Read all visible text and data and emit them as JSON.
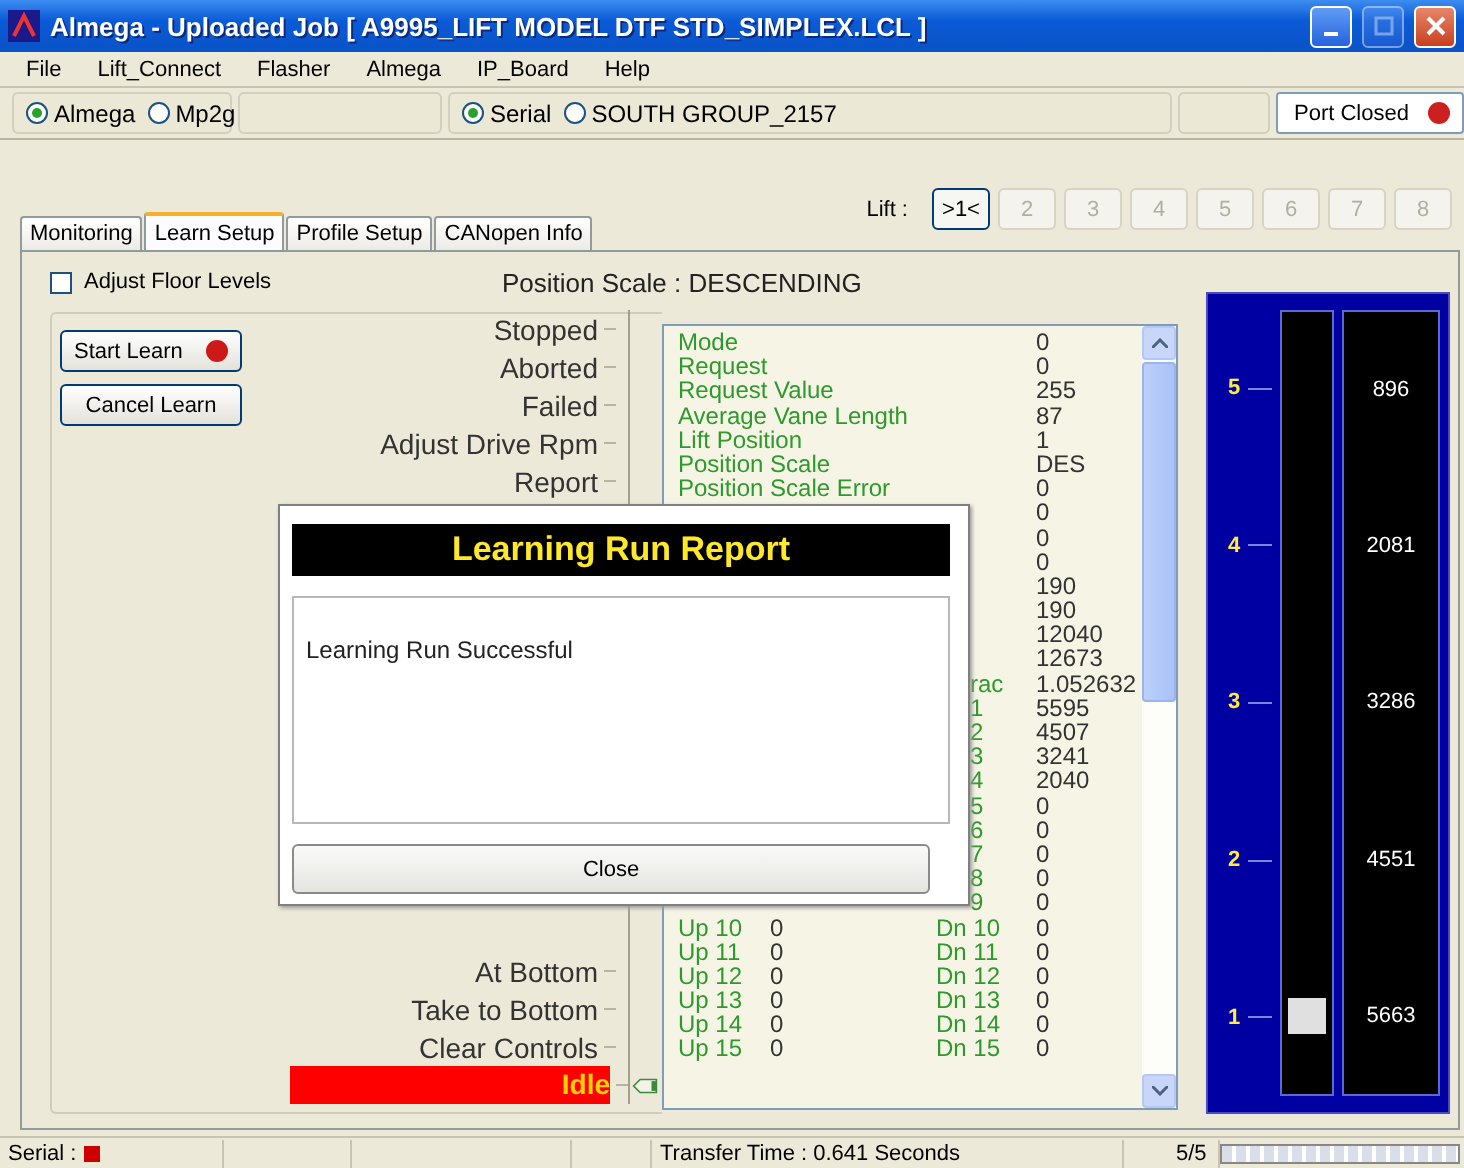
{
  "window": {
    "title": "Almega - Uploaded Job [ A9995_LIFT MODEL DTF STD_SIMPLEX.LCL ]",
    "controls": [
      {
        "kind": "minimize",
        "disabled": false
      },
      {
        "kind": "maximize",
        "disabled": true
      },
      {
        "kind": "close",
        "disabled": false
      }
    ]
  },
  "menu": [
    "File",
    "Lift_Connect",
    "Flasher",
    "Almega",
    "IP_Board",
    "Help"
  ],
  "toolbar": {
    "protocol": [
      {
        "label": "Almega",
        "selected": true
      },
      {
        "label": "Mp2g",
        "selected": false
      }
    ],
    "connection": [
      {
        "label": "Serial",
        "selected": true
      },
      {
        "label": "SOUTH GROUP_2157",
        "selected": false
      }
    ],
    "port": {
      "label": "Port Closed",
      "color": "#cc1f1f"
    }
  },
  "lift_selector": {
    "label": "Lift :",
    "buttons": [
      {
        "label": ">1<",
        "selected": true,
        "disabled": false
      },
      {
        "label": "2",
        "selected": false,
        "disabled": true
      },
      {
        "label": "3",
        "selected": false,
        "disabled": true
      },
      {
        "label": "4",
        "selected": false,
        "disabled": true
      },
      {
        "label": "5",
        "selected": false,
        "disabled": true
      },
      {
        "label": "6",
        "selected": false,
        "disabled": true
      },
      {
        "label": "7",
        "selected": false,
        "disabled": true
      },
      {
        "label": "8",
        "selected": false,
        "disabled": true
      }
    ]
  },
  "tabs": [
    {
      "label": "Monitoring",
      "selected": false
    },
    {
      "label": "Learn Setup",
      "selected": true
    },
    {
      "label": "Profile Setup",
      "selected": false
    },
    {
      "label": "CANopen Info",
      "selected": false
    }
  ],
  "adjust_floor_levels": {
    "label": "Adjust Floor Levels",
    "checked": false
  },
  "position_scale": "Position Scale : DESCENDING",
  "buttons": [
    {
      "label": "Start Learn",
      "indicator": true
    },
    {
      "label": "Cancel Learn",
      "indicator": false
    }
  ],
  "steps_top": [
    "Stopped",
    "Aborted",
    "Failed",
    "Adjust Drive Rpm",
    "Report"
  ],
  "steps_bottom": [
    "At Bottom",
    "Take to Bottom",
    "Clear Controls"
  ],
  "current_step": {
    "label": "Idle",
    "active": true
  },
  "parameters": [
    {
      "kind": "param",
      "label": "Mode",
      "value": "0"
    },
    {
      "kind": "param",
      "label": "Request",
      "value": "0"
    },
    {
      "kind": "param",
      "label": "Request Value",
      "value": "255"
    },
    {
      "kind": "param",
      "label": "Average Vane Length",
      "value": "87"
    },
    {
      "kind": "param",
      "label": "Lift Position",
      "value": "1"
    },
    {
      "kind": "param",
      "label": "Position Scale",
      "value": "DES"
    },
    {
      "kind": "param",
      "label": "Position Scale Error",
      "value": "0"
    },
    {
      "kind": "value",
      "value": "0"
    },
    {
      "kind": "value",
      "value": "0"
    },
    {
      "kind": "value",
      "value": "0"
    },
    {
      "kind": "value",
      "value": "190"
    },
    {
      "kind": "value",
      "value": "190"
    },
    {
      "kind": "value",
      "value": "12040"
    },
    {
      "kind": "value",
      "value": "12673"
    },
    {
      "kind": "tail",
      "label": "rac",
      "value": "1.052632"
    },
    {
      "kind": "tail",
      "label": "1",
      "value": "5595"
    },
    {
      "kind": "tail",
      "label": "2",
      "value": "4507"
    },
    {
      "kind": "tail",
      "label": "3",
      "value": "3241"
    },
    {
      "kind": "tail",
      "label": "4",
      "value": "2040"
    },
    {
      "kind": "tail",
      "label": "5",
      "value": "0"
    },
    {
      "kind": "tail",
      "label": "6",
      "value": "0"
    },
    {
      "kind": "tail",
      "label": "7",
      "value": "0"
    },
    {
      "kind": "tail",
      "label": "8",
      "value": "0"
    },
    {
      "kind": "tail",
      "label": "9",
      "value": "0"
    },
    {
      "kind": "updn",
      "up_label": "Up 10",
      "up_value": "0",
      "dn_label": "Dn 10",
      "dn_value": "0"
    },
    {
      "kind": "updn",
      "up_label": "Up 11",
      "up_value": "0",
      "dn_label": "Dn 11",
      "dn_value": "0"
    },
    {
      "kind": "updn",
      "up_label": "Up 12",
      "up_value": "0",
      "dn_label": "Dn 12",
      "dn_value": "0"
    },
    {
      "kind": "updn",
      "up_label": "Up 13",
      "up_value": "0",
      "dn_label": "Dn 13",
      "dn_value": "0"
    },
    {
      "kind": "updn",
      "up_label": "Up 14",
      "up_value": "0",
      "dn_label": "Dn 14",
      "dn_value": "0"
    },
    {
      "kind": "updn",
      "up_label": "Up 15",
      "up_value": "0",
      "dn_label": "Dn 15",
      "dn_value": "0"
    }
  ],
  "shaft": {
    "floors": [
      {
        "label": "5",
        "count": "896",
        "car": false
      },
      {
        "label": "4",
        "count": "2081",
        "car": false
      },
      {
        "label": "3",
        "count": "3286",
        "car": false
      },
      {
        "label": "2",
        "count": "4551",
        "car": false
      },
      {
        "label": "1",
        "count": "5663",
        "car": true
      }
    ]
  },
  "dialog": {
    "title": "Learning Run Report",
    "message": "Learning Run Successful",
    "button": "Close"
  },
  "status_bar": {
    "serial_label": "Serial :",
    "serial_indicator": {
      "color": "#cc0000"
    },
    "transfer": "Transfer Time : 0.641 Seconds",
    "count": "5/5",
    "progress": {
      "level": 1
    }
  }
}
